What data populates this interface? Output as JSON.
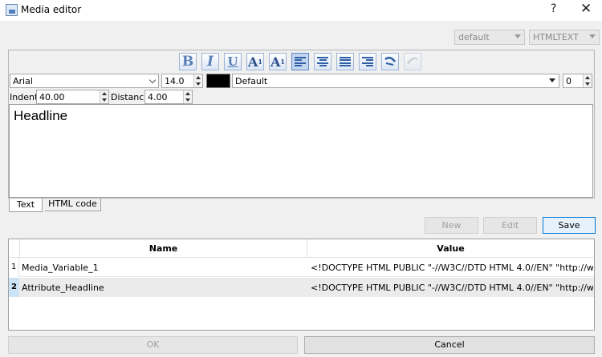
{
  "window": {
    "title": "Media editor",
    "help": "?",
    "close": "✕"
  },
  "top_combos": {
    "style": "default",
    "format": "HTMLTEXT"
  },
  "toolbar": {
    "bold": "B",
    "italic": "I",
    "underline": "U",
    "superscript_main": "A",
    "superscript_mark": "1",
    "subscript_main": "A",
    "subscript_mark": "1"
  },
  "font": {
    "family": "Arial",
    "size": "14.0",
    "color": "#000000",
    "style": "Default",
    "spacing": "0"
  },
  "paragraph": {
    "indent_label": "Indent:",
    "indent": "40.00",
    "distance_label": "Distance:",
    "distance": "4.00"
  },
  "editor": {
    "content": "Headline"
  },
  "tabs": [
    {
      "label": "Text"
    },
    {
      "label": "HTML code"
    }
  ],
  "buttons": {
    "new": "New",
    "edit": "Edit",
    "save": "Save",
    "ok": "OK",
    "cancel": "Cancel"
  },
  "table": {
    "columns": [
      "Name",
      "Value"
    ],
    "rows": [
      {
        "num": "1",
        "name": "Media_Variable_1",
        "value": "<!DOCTYPE HTML PUBLIC \"-//W3C//DTD HTML 4.0//EN\" \"http://www.w..."
      },
      {
        "num": "2",
        "name": "Attribute_Headline",
        "value": "<!DOCTYPE HTML PUBLIC \"-//W3C//DTD HTML 4.0//EN\" \"http://www.w..."
      }
    ]
  }
}
